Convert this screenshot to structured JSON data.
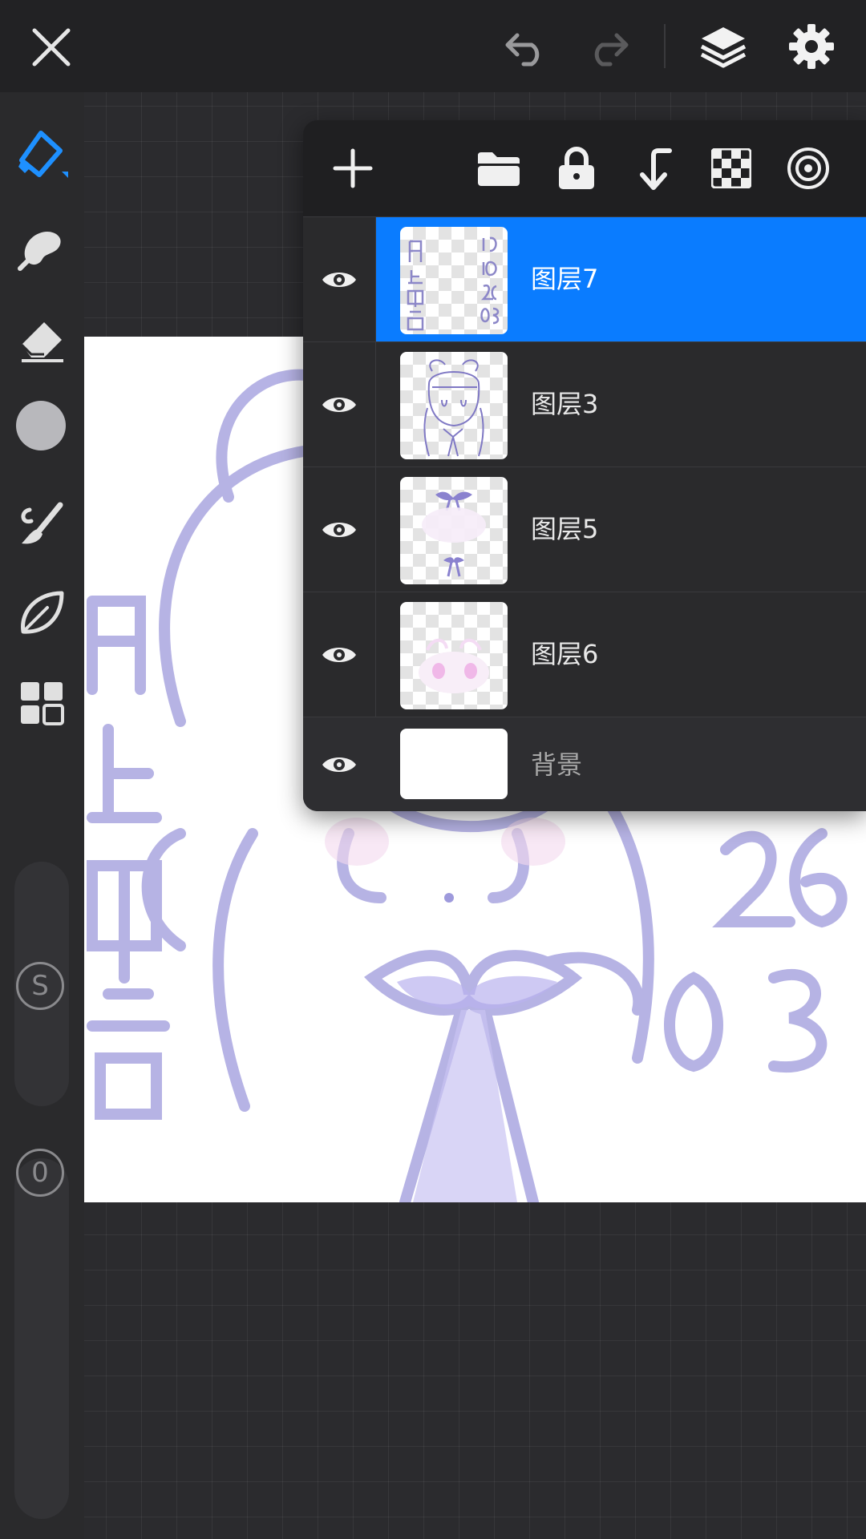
{
  "toolbar": {
    "close_icon": "close-icon",
    "undo_icon": "undo-icon",
    "redo_icon": "redo-icon",
    "layers_icon": "layers-icon",
    "settings_icon": "gear-icon"
  },
  "sidebar": {
    "tools": [
      {
        "name": "pen-tool",
        "icon": "pen-icon",
        "active": true
      },
      {
        "name": "smudge-tool",
        "icon": "smudge-icon"
      },
      {
        "name": "eraser-tool",
        "icon": "eraser-icon"
      },
      {
        "name": "color-picker",
        "icon": "color-swatch-icon"
      },
      {
        "name": "brush-library",
        "icon": "brush-icon"
      },
      {
        "name": "leaf-tool",
        "icon": "leaf-icon"
      },
      {
        "name": "gallery",
        "icon": "grid-icon"
      }
    ],
    "size_label": "S",
    "opacity_label": "0"
  },
  "layers_panel": {
    "toolbar_icons": [
      "add-icon",
      "folder-icon",
      "lock-icon",
      "merge-down-icon",
      "checkerboard-icon",
      "reference-icon"
    ],
    "layers": [
      {
        "name": "图层7",
        "visible": true,
        "selected": true
      },
      {
        "name": "图层3",
        "visible": true,
        "selected": false
      },
      {
        "name": "图层5",
        "visible": true,
        "selected": false
      },
      {
        "name": "图层6",
        "visible": true,
        "selected": false
      },
      {
        "name": "背景",
        "visible": true,
        "selected": false
      }
    ]
  },
  "colors": {
    "accent": "#0a7cff",
    "sketch": "#9e9adc",
    "panel": "#1f1f21"
  }
}
